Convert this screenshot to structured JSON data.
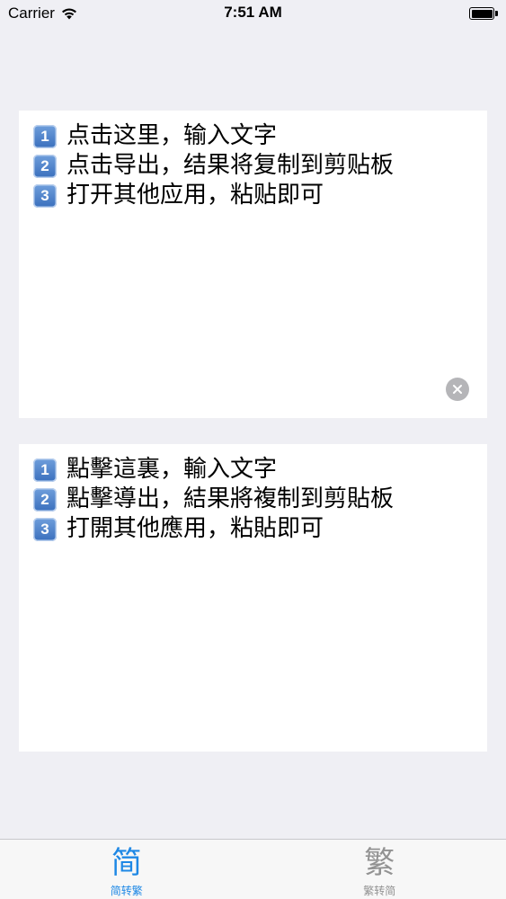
{
  "status_bar": {
    "carrier": "Carrier",
    "time": "7:51 AM",
    "wifi_icon": "wifi-icon",
    "battery_icon": "battery-icon"
  },
  "simplified_box": {
    "lines": [
      {
        "num": "1",
        "text": "点击这里，输入文字"
      },
      {
        "num": "2",
        "text": "点击导出，结果将复制到剪贴板"
      },
      {
        "num": "3",
        "text": "打开其他应用，粘贴即可"
      }
    ],
    "clear_icon": "clear-icon"
  },
  "traditional_box": {
    "lines": [
      {
        "num": "1",
        "text": "點擊這裏，輸入文字"
      },
      {
        "num": "2",
        "text": "點擊導出，結果將複制到剪貼板"
      },
      {
        "num": "3",
        "text": "打開其他應用，粘貼即可"
      }
    ]
  },
  "tab_bar": {
    "tabs": [
      {
        "icon": "简",
        "label": "简转繁",
        "active": true
      },
      {
        "icon": "繁",
        "label": "繁转简",
        "active": false
      }
    ],
    "colors": {
      "active": "#1e88e5",
      "inactive": "#929292"
    }
  }
}
